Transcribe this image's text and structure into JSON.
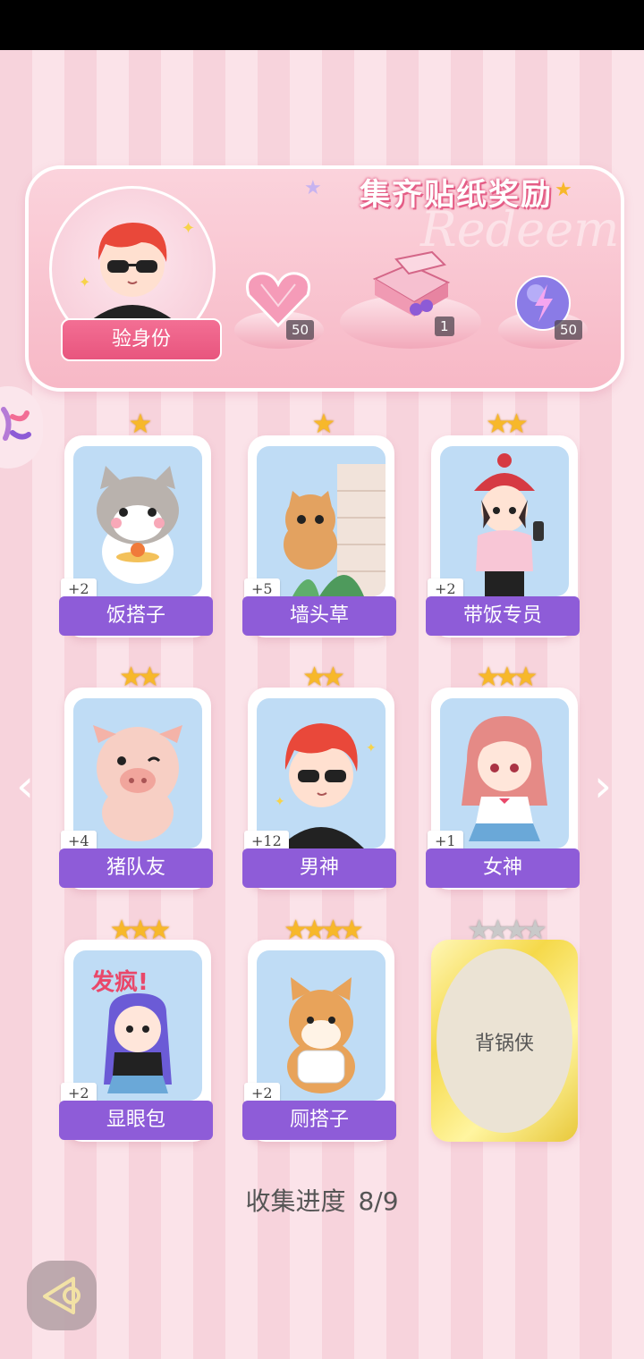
{
  "banner": {
    "title": "集齐贴纸奖励",
    "deco_text": "Redeem",
    "identity_button": "验身份",
    "rewards": [
      {
        "icon": "heart-gem-icon",
        "count": "50"
      },
      {
        "icon": "gift-box-icon",
        "count": "1"
      },
      {
        "icon": "lightning-orb-icon",
        "count": "50"
      }
    ]
  },
  "cards": [
    {
      "name": "饭搭子",
      "count": "+2",
      "stars": "★",
      "locked": false
    },
    {
      "name": "墙头草",
      "count": "+5",
      "stars": "★",
      "locked": false
    },
    {
      "name": "带饭专员",
      "count": "+2",
      "stars": "★★",
      "locked": false
    },
    {
      "name": "猪队友",
      "count": "+4",
      "stars": "★★",
      "locked": false
    },
    {
      "name": "男神",
      "count": "+12",
      "stars": "★★",
      "locked": false
    },
    {
      "name": "女神",
      "count": "+1",
      "stars": "★★★",
      "locked": false
    },
    {
      "name": "显眼包",
      "count": "+2",
      "stars": "★★★",
      "locked": false
    },
    {
      "name": "厕搭子",
      "count": "+2",
      "stars": "★★★★",
      "locked": false
    },
    {
      "name": "背锅侠",
      "count": "",
      "stars": "★★★★",
      "locked": true
    }
  ],
  "card_art": {
    "c6_text": "发疯!"
  },
  "nav": {
    "prev": "‹",
    "next": "›"
  },
  "progress": {
    "label": "收集进度",
    "value": "8/9"
  },
  "colors": {
    "accent": "#8e5cd8",
    "pink": "#f36f94",
    "gold": "#f7b82a"
  }
}
